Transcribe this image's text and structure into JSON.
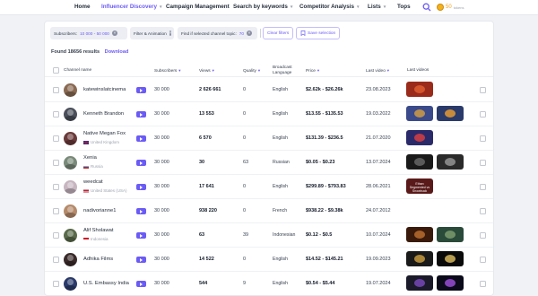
{
  "nav": {
    "items": [
      {
        "label": "Home",
        "active": false,
        "caret": false
      },
      {
        "label": "Influencer Discovery",
        "active": true,
        "caret": true
      },
      {
        "label": "Campaign Management",
        "active": false,
        "caret": false
      },
      {
        "label": "Search by keywords",
        "active": false,
        "caret": true
      },
      {
        "label": "Competitor Analysis",
        "active": false,
        "caret": true
      },
      {
        "label": "Lists",
        "active": false,
        "caret": true
      },
      {
        "label": "Tops",
        "active": false,
        "caret": false
      }
    ],
    "coins": "50",
    "coins_sub": "tokens"
  },
  "filters": {
    "chip1_label": "Subscribers:",
    "chip1_value": "10 000 - 50 000",
    "chip2_label": "Filter & Animation",
    "chip3_label": "Find if selected channel topic:",
    "chip3_value": "70",
    "clear_label": "Clear filters",
    "save_label": "Save selection"
  },
  "results": {
    "count": "Found 18656 results",
    "download": "Download"
  },
  "columns": {
    "channel": "Channel name",
    "subscribers": "Subscribers",
    "views": "Views",
    "quality": "Quality",
    "language": "Broadcast Language",
    "price": "Price",
    "last_video": "Last video",
    "last_videos": "Last videos"
  },
  "rows": [
    {
      "name": "katewinslatcinema",
      "country": "",
      "subscribers": "30 000",
      "views": "2 626 661",
      "quality": "0",
      "language": "English",
      "price": "$2.62k - $26.26k",
      "last_video": "23.08.2023",
      "avatar": "#8a6a52",
      "thumbs": [
        {
          "color": "#9a2a1a",
          "hl": "#e06030",
          "text": ""
        }
      ]
    },
    {
      "name": "Kenneth Brandon",
      "country": "",
      "subscribers": "30 000",
      "views": "13 553",
      "quality": "0",
      "language": "English",
      "price": "$13.55 - $135.53",
      "last_video": "19.03.2022",
      "avatar": "#4a4f5a",
      "thumbs": [
        {
          "color": "#3a4a8a",
          "hl": "#d8a040",
          "text": ""
        },
        {
          "color": "#2a3a6a",
          "hl": "#f0a030",
          "text": ""
        }
      ]
    },
    {
      "name": "Native Megan Fox",
      "country": "United Kingdom",
      "subscribers": "30 000",
      "views": "6 570",
      "quality": "0",
      "language": "English",
      "price": "$131.39 - $236.5",
      "last_video": "21.07.2020",
      "avatar": "#6a3a3a",
      "thumbs": [
        {
          "color": "#2a2a6a",
          "hl": "#e04040",
          "text": ""
        }
      ]
    },
    {
      "name": "Xenia",
      "country": "Russia",
      "subscribers": "30 000",
      "views": "30",
      "quality": "63",
      "language": "Russian",
      "price": "$0.05 - $0.23",
      "last_video": "13.07.2024",
      "avatar": "#7a8a7a",
      "thumbs": [
        {
          "color": "#1a1a1a",
          "hl": "#6a6a6a",
          "text": ""
        },
        {
          "color": "#2a2a2a",
          "hl": "#9a9a9a",
          "text": ""
        }
      ]
    },
    {
      "name": "weedcat",
      "country": "United States (USA)",
      "subscribers": "30 000",
      "views": "17 641",
      "quality": "0",
      "language": "English",
      "price": "$299.89 - $793.83",
      "last_video": "28.06.2021",
      "avatar": "#c7b6c0",
      "thumbs": [
        {
          "color": "#5a1a1a",
          "hl": "#3a0a0a",
          "text": "Ethan Segmented vs Snowbuck"
        }
      ]
    },
    {
      "name": "nadivorianne1",
      "country": "",
      "subscribers": "30 000",
      "views": "938 220",
      "quality": "0",
      "language": "French",
      "price": "$938.22 - $9.38k",
      "last_video": "24.07.2012",
      "avatar": "#b58a6a",
      "thumbs": []
    },
    {
      "name": "Alif Sholawat",
      "country": "Indonesia",
      "subscribers": "30 000",
      "views": "63",
      "quality": "39",
      "language": "Indonesian",
      "price": "$0.12 - $0.5",
      "last_video": "10.07.2024",
      "avatar": "#5a6a4a",
      "thumbs": [
        {
          "color": "#3a1a0a",
          "hl": "#c07030",
          "text": ""
        },
        {
          "color": "#2a4a3a",
          "hl": "#80a070",
          "text": ""
        }
      ]
    },
    {
      "name": "Adhika Films",
      "country": "",
      "subscribers": "30 000",
      "views": "14 522",
      "quality": "0",
      "language": "English",
      "price": "$14.52 - $145.21",
      "last_video": "19.09.2023",
      "avatar": "#3a2a2a",
      "thumbs": [
        {
          "color": "#1a1a1a",
          "hl": "#d0a040",
          "text": ""
        },
        {
          "color": "#0a0a0a",
          "hl": "#e0c060",
          "text": ""
        }
      ]
    },
    {
      "name": "U.S. Embassy India",
      "country": "",
      "subscribers": "30 000",
      "views": "544",
      "quality": "9",
      "language": "English",
      "price": "$0.54 - $5.44",
      "last_video": "19.07.2024",
      "avatar": "#2a3a6a",
      "thumbs": [
        {
          "color": "#1a1a2a",
          "hl": "#7a4ac0",
          "text": ""
        },
        {
          "color": "#0a0a1a",
          "hl": "#a050e0",
          "text": ""
        }
      ]
    }
  ]
}
